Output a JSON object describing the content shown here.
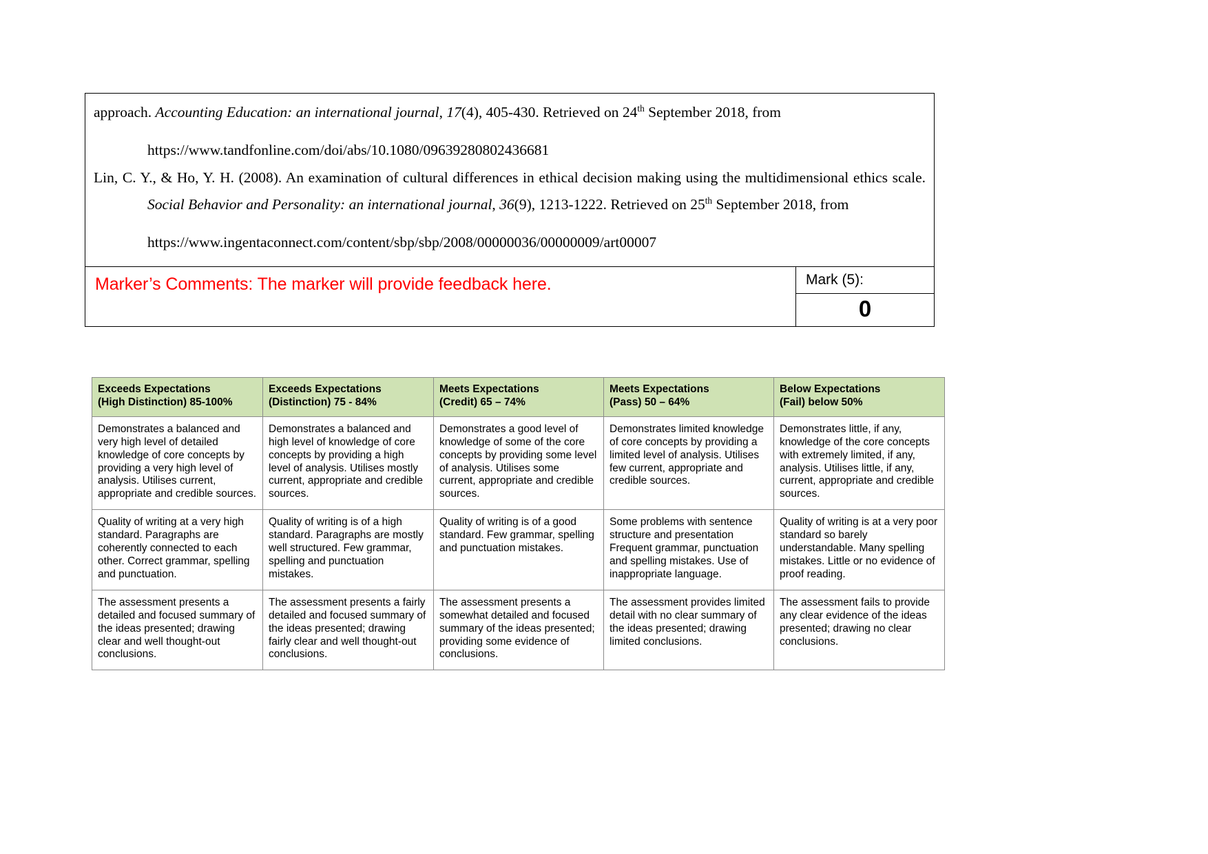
{
  "document": {
    "references": [
      {
        "id": "ref-1-continuation",
        "segments": [
          {
            "text": "approach. ",
            "style": "normal"
          },
          {
            "text": "Accounting Education: an international journal",
            "style": "italic"
          },
          {
            "text": ", ",
            "style": "normal"
          },
          {
            "text": "17",
            "style": "italic"
          },
          {
            "text": "(4), 405-430. Retrieved on 24",
            "style": "normal"
          },
          {
            "text": "th",
            "style": "superscript"
          },
          {
            "text": " September 2018, from",
            "style": "normal"
          }
        ],
        "plain": "approach. Accounting Education: an international journal, 17(4), 405-430. Retrieved on 24th September 2018, from",
        "url": "https://www.tandfonline.com/doi/abs/10.1080/09639280802436681"
      },
      {
        "id": "ref-2",
        "segments": [
          {
            "text": "Lin, C. Y., & Ho, Y. H. (2008). An examination of cultural differences in ethical decision making using the multidimensional ethics scale. ",
            "style": "normal"
          },
          {
            "text": "Social Behavior and Personality: an international journal",
            "style": "italic"
          },
          {
            "text": ", ",
            "style": "normal"
          },
          {
            "text": "36",
            "style": "italic"
          },
          {
            "text": "(9), 1213-1222. Retrieved on 25",
            "style": "normal"
          },
          {
            "text": "th",
            "style": "superscript"
          },
          {
            "text": " September 2018, from",
            "style": "normal"
          }
        ],
        "plain": "Lin, C. Y., & Ho, Y. H. (2008). An examination of cultural differences in ethical decision making using the multidimensional ethics scale. Social Behavior and Personality: an international journal, 36(9), 1213-1222. Retrieved on 25th September 2018, from",
        "url": "https://www.ingentaconnect.com/content/sbp/sbp/2008/00000036/00000009/art00007"
      }
    ],
    "marker": {
      "comments_text": "Marker’s Comments: The marker will provide feedback here.",
      "comments_color": "#ff0000",
      "mark_label": "Mark (5):",
      "mark_value": "0"
    }
  },
  "rubric": {
    "header_background": "#cfe2b4",
    "border_color": "#8a8a8a",
    "columns": [
      {
        "line1": "Exceeds Expectations",
        "line2": "(High Distinction) 85-100%"
      },
      {
        "line1": "Exceeds Expectations",
        "line2": "(Distinction) 75 - 84%"
      },
      {
        "line1": "Meets Expectations",
        "line2": "(Credit) 65 – 74%"
      },
      {
        "line1": "Meets Expectations",
        "line2": "(Pass) 50 – 64%"
      },
      {
        "line1": "Below Expectations",
        "line2": "(Fail) below 50%"
      }
    ],
    "rows": [
      {
        "criterion": "knowledge-and-sources",
        "cells": [
          "Demonstrates a balanced and very high level of detailed knowledge of core concepts by providing a very high level of analysis. Utilises current, appropriate and credible sources.",
          "Demonstrates a balanced and high level of knowledge of core concepts by providing a high level of analysis. Utilises mostly current, appropriate and credible sources.",
          "Demonstrates a good level of knowledge of some of the core concepts by providing some level of analysis. Utilises some current, appropriate and credible sources.",
          "Demonstrates limited knowledge of core concepts by providing a limited level of analysis. Utilises few current, appropriate and credible sources.",
          "Demonstrates little, if any, knowledge of the core concepts with extremely limited, if any, analysis. Utilises little, if any, current, appropriate and credible sources."
        ]
      },
      {
        "criterion": "quality-of-writing",
        "cells": [
          "Quality of writing at a very high standard. Paragraphs are coherently connected to each other. Correct grammar, spelling and punctuation.",
          "Quality of writing is of a high standard. Paragraphs are mostly well structured. Few grammar, spelling and punctuation mistakes.",
          "Quality of writing is of a good standard. Few grammar, spelling and punctuation mistakes.",
          "Some problems with sentence structure and presentation Frequent grammar, punctuation and spelling mistakes. Use of inappropriate language.",
          "Quality of writing is at a very poor standard so barely understandable. Many spelling mistakes. Little or no evidence of proof reading."
        ]
      },
      {
        "criterion": "summary-and-conclusions",
        "cells": [
          "The assessment presents a detailed and focused summary of the ideas presented; drawing clear and well thought-out conclusions.",
          "The assessment presents a fairly detailed and focused summary of the ideas presented; drawing fairly clear and well thought-out conclusions.",
          "The assessment presents a somewhat detailed and focused summary of the ideas presented; providing some evidence of conclusions.",
          "The assessment provides limited detail with no clear summary of the ideas presented; drawing limited conclusions.",
          "The assessment fails to provide any clear evidence of the ideas presented; drawing no clear conclusions."
        ]
      }
    ]
  }
}
